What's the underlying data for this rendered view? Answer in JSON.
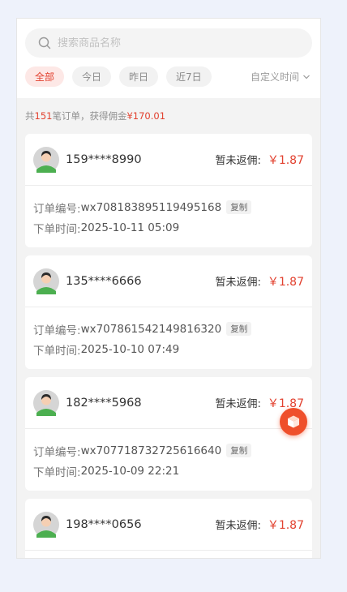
{
  "search": {
    "placeholder": "搜索商品名称"
  },
  "filters": {
    "chips": [
      {
        "label": "全部"
      },
      {
        "label": "今日"
      },
      {
        "label": "昨日"
      },
      {
        "label": "近7日"
      }
    ],
    "custom_label": "自定义时间"
  },
  "summary": {
    "prefix": "共 ",
    "count": "151",
    "middle": " 笔订单，获得佣金 ",
    "amount": "¥170.01"
  },
  "labels": {
    "rebate": "暂未返佣:",
    "order_no": "订单编号:",
    "order_time": "下单时间:",
    "copy": "复制"
  },
  "orders": [
    {
      "phone": "159****8990",
      "amount": "￥1.87",
      "order_no": "wx708183895119495168",
      "time": "2025-10-11 05:09"
    },
    {
      "phone": "135****6666",
      "amount": "￥1.87",
      "order_no": "wx707861542149816320",
      "time": "2025-10-10 07:49"
    },
    {
      "phone": "182****5968",
      "amount": "￥1.87",
      "order_no": "wx707718732725616640",
      "time": "2025-10-09 22:21"
    },
    {
      "phone": "198****0656",
      "amount": "￥1.87",
      "order_no": "",
      "time": ""
    }
  ],
  "colors": {
    "accent": "#e2412f",
    "fab": "#ef4f2b"
  },
  "icons": {
    "search": "search-icon",
    "dropdown": "chevron-down-icon",
    "fab": "cube-icon"
  }
}
